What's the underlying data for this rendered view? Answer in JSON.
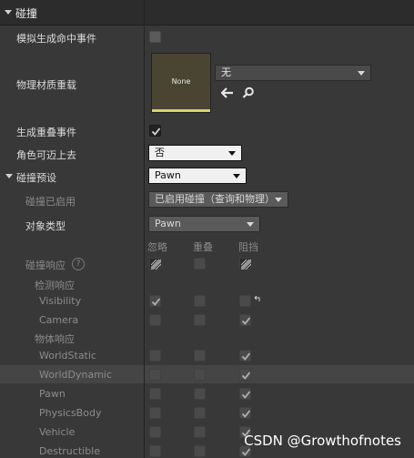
{
  "section": {
    "title": "碰撞"
  },
  "fields": {
    "simulate_hit_events": "模拟生成命中事件",
    "phys_material_override": "物理材质重载",
    "generate_overlap_events": "生成重叠事件",
    "can_character_step_up": "角色可迈上去",
    "collision_presets": "碰撞预设",
    "collision_enabled": "碰撞已启用",
    "object_type": "对象类型",
    "collision_responses": "碰撞响应",
    "trace_responses": "检测响应",
    "object_responses": "物体响应"
  },
  "material": {
    "thumbnail_text": "None",
    "selected": "无"
  },
  "dropdowns": {
    "step_up": "否",
    "presets": "Pawn",
    "enabled": "已启用碰撞（查询和物理）",
    "object_type": "Pawn"
  },
  "columns": {
    "ignore": "忽略",
    "overlap": "重叠",
    "block": "阻挡"
  },
  "trace_rows": [
    {
      "label": "Visibility",
      "ignore": true,
      "overlap": false,
      "block": false
    },
    {
      "label": "Camera",
      "ignore": false,
      "overlap": false,
      "block": true
    }
  ],
  "object_rows": [
    {
      "label": "WorldStatic",
      "ignore": false,
      "overlap": false,
      "block": true
    },
    {
      "label": "WorldDynamic",
      "ignore": false,
      "overlap": false,
      "block": true
    },
    {
      "label": "Pawn",
      "ignore": false,
      "overlap": false,
      "block": true
    },
    {
      "label": "PhysicsBody",
      "ignore": false,
      "overlap": false,
      "block": true
    },
    {
      "label": "Vehicle",
      "ignore": false,
      "overlap": false,
      "block": true
    },
    {
      "label": "Destructible",
      "ignore": false,
      "overlap": false,
      "block": true
    }
  ],
  "watermark": "CSDN @Growthofnotes"
}
